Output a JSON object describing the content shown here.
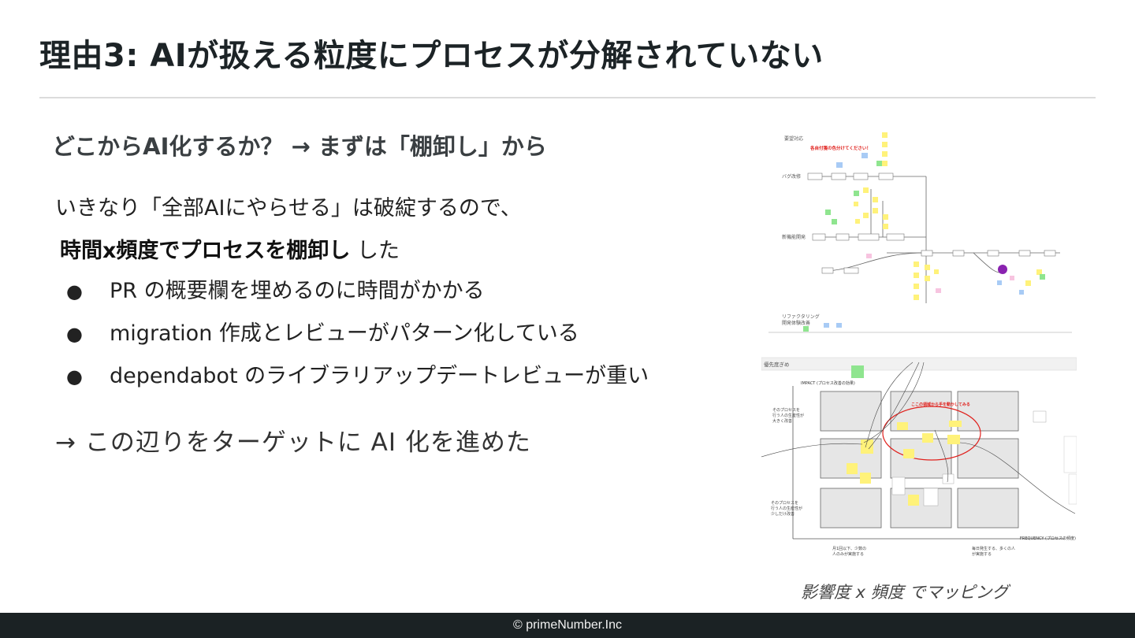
{
  "title": "理由3: AIが扱える粒度にプロセスが分解されていない",
  "subtitle": "どこからAI化するか？ → まずは「棚卸し」から",
  "intro": "いきなり「全部AIにやらせる」は破綻するので、",
  "lead": {
    "bold": "時間x頻度でプロセスを棚卸し",
    "rest": " した"
  },
  "bullets": [
    "PR の概要欄を埋めるのに時間がかかる",
    "migration 作成とレビューがパターン化している",
    "dependabot のライブラリアップデートレビューが重い"
  ],
  "bullet_glyph": "●",
  "conclusion": "→ この辺りをターゲットに AI 化を進めた",
  "figure_top": {
    "row_labels": [
      "要望対応",
      "バグ改修",
      "新機能開発",
      "リファクタリング",
      "開発体験改善"
    ],
    "red_note": "各自付箋の色分けてください！"
  },
  "figure_bottom": {
    "header": "優先度ぎめ",
    "y_axis": "IMPACT (プロセス改善の効果)",
    "x_axis": "FREQUENCY (プロセスの頻度)",
    "top_left_note": [
      "そのプロセスを",
      "行う人の生産性が",
      "大きく改善"
    ],
    "bottom_left_note": [
      "そのプロセスを",
      "行う人の生産性が",
      "少しだけ改善"
    ],
    "x_left_note": [
      "月1回以下、少数の",
      "人のみが実施する"
    ],
    "x_right_note": [
      "毎日発生する、多くの人",
      "が実施する"
    ],
    "ellipse_note": "ここの領域から手を動かしてみる"
  },
  "caption": "影響度 x 頻度 でマッピング",
  "footer": "© primeNumber.Inc",
  "colors": {
    "sticky_yellow": "#fff27a",
    "sticky_green": "#8fe58f",
    "sticky_blue": "#a8cbf5",
    "sticky_pink": "#f7c4e0",
    "accent_red": "#e0201c",
    "accent_purple": "#8a22b0"
  }
}
